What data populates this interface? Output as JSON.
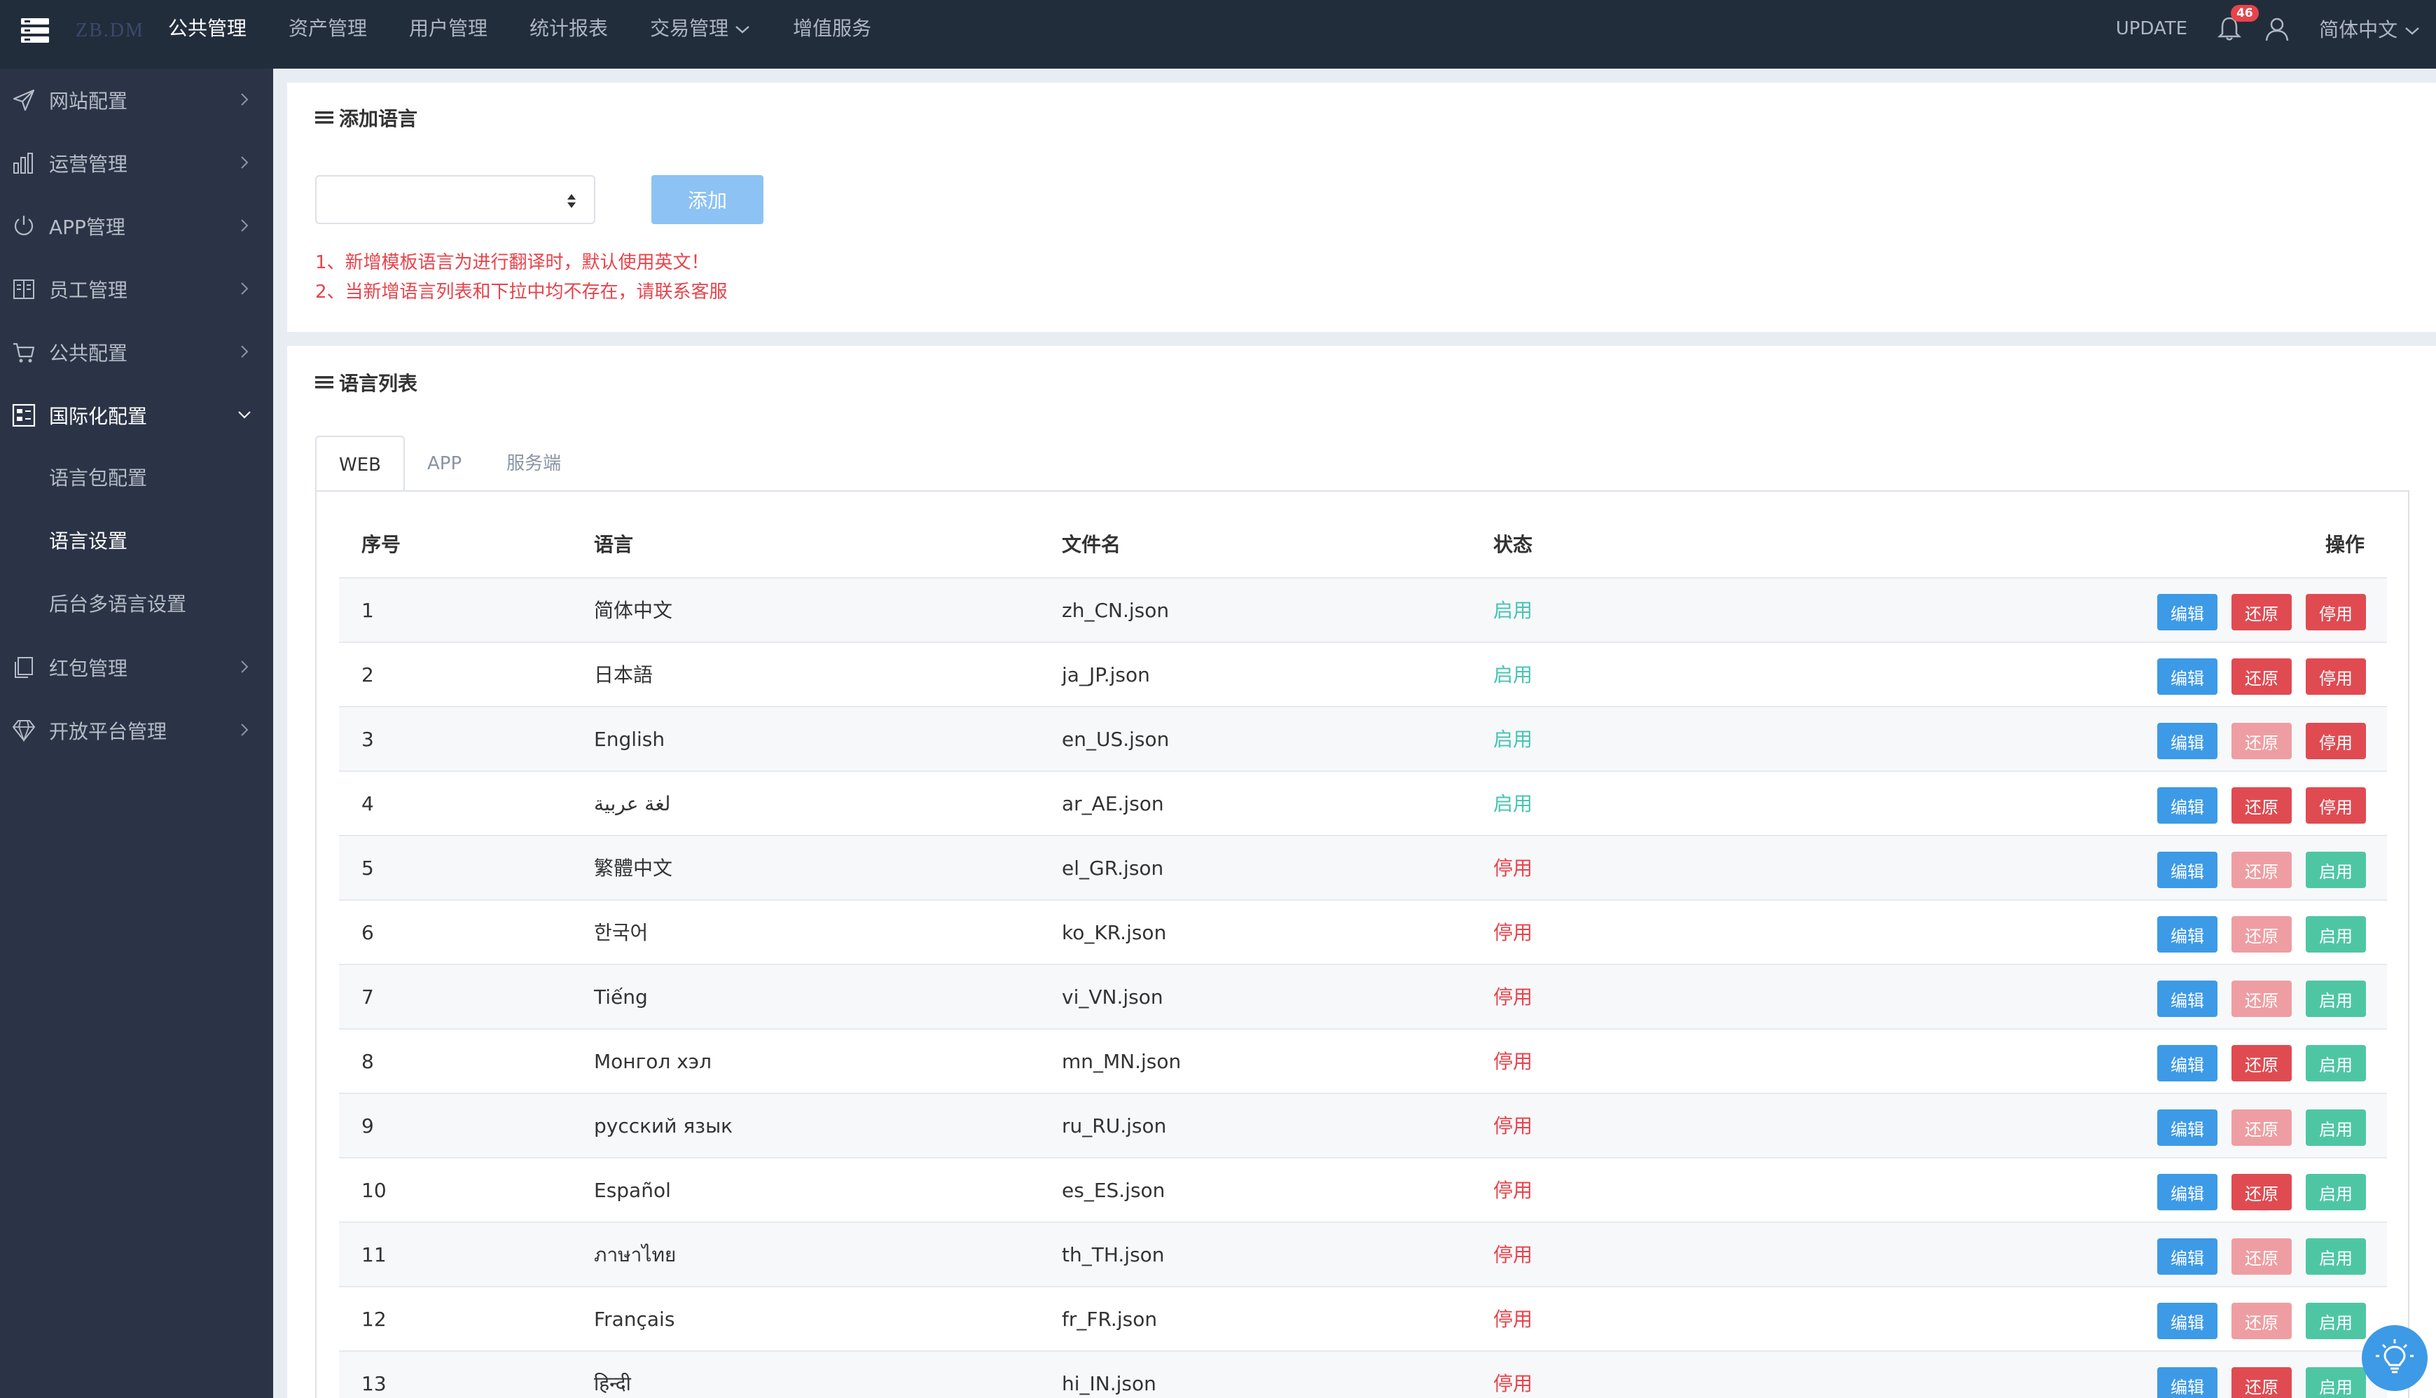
{
  "topbar": {
    "logo": "ZB.DM",
    "nav": [
      {
        "label": "公共管理",
        "active": true
      },
      {
        "label": "资产管理"
      },
      {
        "label": "用户管理"
      },
      {
        "label": "统计报表"
      },
      {
        "label": "交易管理"
      },
      {
        "label": "增值服务"
      }
    ],
    "update_label": "UPDATE",
    "notification_count": "46",
    "language": "简体中文"
  },
  "sidebar": {
    "items": [
      {
        "label": "网站配置",
        "icon": "send-icon"
      },
      {
        "label": "运营管理",
        "icon": "bar-chart-icon"
      },
      {
        "label": "APP管理",
        "icon": "power-icon"
      },
      {
        "label": "员工管理",
        "icon": "book-icon"
      },
      {
        "label": "公共配置",
        "icon": "cart-icon"
      },
      {
        "label": "国际化配置",
        "icon": "grid-icon",
        "open": true
      },
      {
        "label": "红包管理",
        "icon": "copy-icon"
      },
      {
        "label": "开放平台管理",
        "icon": "diamond-icon"
      }
    ],
    "subitems": [
      {
        "label": "语言包配置"
      },
      {
        "label": "语言设置",
        "active": true
      },
      {
        "label": "后台多语言设置"
      }
    ]
  },
  "add_language": {
    "title": "添加语言",
    "select_value": "",
    "add_button": "添加",
    "notes": [
      "1、新增模板语言为进行翻译时，默认使用英文！",
      "2、当新增语言列表和下拉中均不存在，请联系客服"
    ]
  },
  "language_list": {
    "title": "语言列表",
    "tabs": [
      {
        "label": "WEB",
        "active": true
      },
      {
        "label": "APP"
      },
      {
        "label": "服务端"
      }
    ],
    "columns": [
      "序号",
      "语言",
      "文件名",
      "状态",
      "操作"
    ],
    "rows": [
      {
        "index": "1",
        "language": "简体中文",
        "file": "zh_CN.json",
        "status": "启用",
        "enabled": true,
        "edit": "编辑",
        "restore": "还原",
        "restore_enabled": true,
        "toggle": "停用"
      },
      {
        "index": "2",
        "language": "日本語",
        "file": "ja_JP.json",
        "status": "启用",
        "enabled": true,
        "edit": "编辑",
        "restore": "还原",
        "restore_enabled": true,
        "toggle": "停用"
      },
      {
        "index": "3",
        "language": "English",
        "file": "en_US.json",
        "status": "启用",
        "enabled": true,
        "edit": "编辑",
        "restore": "还原",
        "restore_enabled": false,
        "toggle": "停用"
      },
      {
        "index": "4",
        "language": "لغة عربية",
        "file": "ar_AE.json",
        "status": "启用",
        "enabled": true,
        "edit": "编辑",
        "restore": "还原",
        "restore_enabled": true,
        "toggle": "停用"
      },
      {
        "index": "5",
        "language": "繁體中文",
        "file": "el_GR.json",
        "status": "停用",
        "enabled": false,
        "edit": "编辑",
        "restore": "还原",
        "restore_enabled": false,
        "toggle": "启用"
      },
      {
        "index": "6",
        "language": "한국어",
        "file": "ko_KR.json",
        "status": "停用",
        "enabled": false,
        "edit": "编辑",
        "restore": "还原",
        "restore_enabled": false,
        "toggle": "启用"
      },
      {
        "index": "7",
        "language": "Tiếng",
        "file": "vi_VN.json",
        "status": "停用",
        "enabled": false,
        "edit": "编辑",
        "restore": "还原",
        "restore_enabled": false,
        "toggle": "启用"
      },
      {
        "index": "8",
        "language": "Монгол хэл",
        "file": "mn_MN.json",
        "status": "停用",
        "enabled": false,
        "edit": "编辑",
        "restore": "还原",
        "restore_enabled": true,
        "toggle": "启用"
      },
      {
        "index": "9",
        "language": "русский язык",
        "file": "ru_RU.json",
        "status": "停用",
        "enabled": false,
        "edit": "编辑",
        "restore": "还原",
        "restore_enabled": false,
        "toggle": "启用"
      },
      {
        "index": "10",
        "language": "Español",
        "file": "es_ES.json",
        "status": "停用",
        "enabled": false,
        "edit": "编辑",
        "restore": "还原",
        "restore_enabled": true,
        "toggle": "启用"
      },
      {
        "index": "11",
        "language": "ภาษาไทย",
        "file": "th_TH.json",
        "status": "停用",
        "enabled": false,
        "edit": "编辑",
        "restore": "还原",
        "restore_enabled": false,
        "toggle": "启用"
      },
      {
        "index": "12",
        "language": "Français",
        "file": "fr_FR.json",
        "status": "停用",
        "enabled": false,
        "edit": "编辑",
        "restore": "还原",
        "restore_enabled": false,
        "toggle": "启用"
      },
      {
        "index": "13",
        "language": "हिन्दी",
        "file": "hi_IN.json",
        "status": "停用",
        "enabled": false,
        "edit": "编辑",
        "restore": "还原",
        "restore_enabled": true,
        "toggle": "启用"
      }
    ]
  },
  "colors": {
    "topbar": "#222d3c",
    "sidebar": "#2b3446",
    "primary": "#3d9ae6",
    "danger": "#e04b52",
    "success": "#4ec6a4",
    "status_on": "#48c4b4",
    "status_off": "#e8434b"
  }
}
